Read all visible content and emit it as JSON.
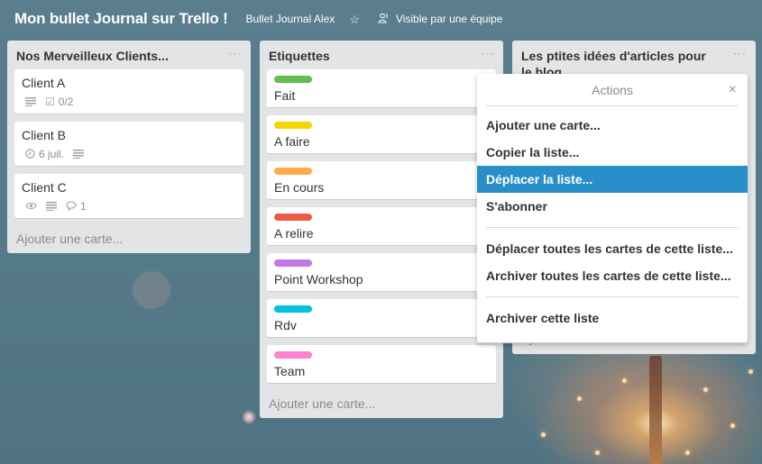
{
  "header": {
    "board_title": "Mon bullet Journal sur Trello !",
    "team_name": "Bullet Journal Alex",
    "star_icon": "star-icon",
    "visibility_icon": "team-icon",
    "visibility_label": "Visible par une équipe"
  },
  "lists": [
    {
      "title": "Nos Merveilleux Clients...",
      "menu_icon": "···",
      "add_card": "Ajouter une carte...",
      "cards": [
        {
          "title": "Client A",
          "badges": {
            "description": "description-icon",
            "checklist": "0/2"
          }
        },
        {
          "title": "Client B",
          "badges": {
            "due": "6 juil.",
            "description": "description-icon"
          }
        },
        {
          "title": "Client C",
          "badges": {
            "watch": "eye-icon",
            "description": "description-icon",
            "comments": "1"
          }
        }
      ]
    },
    {
      "title": "Etiquettes",
      "menu_icon": "···",
      "add_card": "Ajouter une carte...",
      "cards": [
        {
          "title": "Fait",
          "label_color": "#61bd4f"
        },
        {
          "title": "A faire",
          "label_color": "#f2d600"
        },
        {
          "title": "En cours",
          "label_color": "#ffab4a"
        },
        {
          "title": "A relire",
          "label_color": "#eb5a46"
        },
        {
          "title": "Point Workshop",
          "label_color": "#c377e0"
        },
        {
          "title": "Rdv",
          "label_color": "#00c2e0"
        },
        {
          "title": "Team",
          "label_color": "#ff80ce"
        }
      ]
    },
    {
      "title": "Les ptites idées d'articles pour le blog",
      "menu_icon": "···",
      "add_card": "Ajouter une carte..."
    }
  ],
  "popover": {
    "title": "Actions",
    "close_icon": "×",
    "sections": [
      [
        "Ajouter une carte...",
        "Copier la liste...",
        "Déplacer la liste...",
        "S'abonner"
      ],
      [
        "Déplacer toutes les cartes de cette liste...",
        "Archiver toutes les cartes de cette liste..."
      ],
      [
        "Archiver cette liste"
      ]
    ],
    "active_item": "Déplacer la liste..."
  },
  "colors": {
    "active_item_bg": "#298fca",
    "list_bg": "#e2e4e6"
  }
}
